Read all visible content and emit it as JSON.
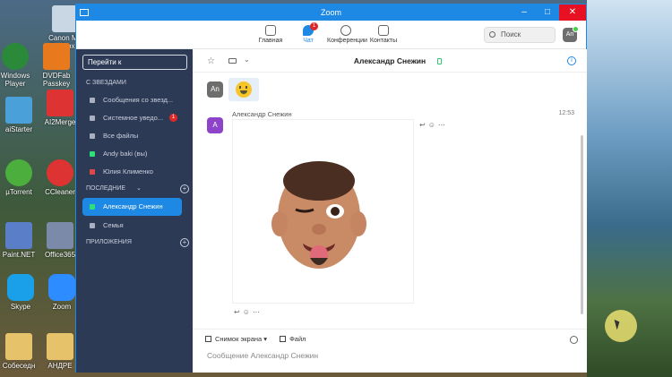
{
  "window": {
    "title": "Zoom"
  },
  "nav": [
    {
      "label": "Главная",
      "icon": "home-icon"
    },
    {
      "label": "Чат",
      "icon": "chat-icon",
      "badge": "1"
    },
    {
      "label": "Конференции",
      "icon": "clock-icon"
    },
    {
      "label": "Контакты",
      "icon": "contacts-icon"
    }
  ],
  "search": {
    "placeholder": "Поиск"
  },
  "user": {
    "avatar": "An"
  },
  "sidebar": {
    "goto": "Перейти к",
    "starred_label": "С ЗВЕЗДАМИ",
    "starred": [
      {
        "label": "Сообщения со звезд..."
      },
      {
        "label": "Системное уведо...",
        "count": "1"
      },
      {
        "label": "Все файлы"
      },
      {
        "label": "Andy baki (вы)"
      },
      {
        "label": "Юлия Клименко"
      }
    ],
    "recent_label": "ПОСЛЕДНИЕ",
    "recent": [
      {
        "label": "Александр Снежин"
      },
      {
        "label": "Семья"
      }
    ],
    "apps_label": "ПРИЛОЖЕНИЯ"
  },
  "chat": {
    "contact": "Александр Снежин",
    "messages": [
      {
        "avatar": "An",
        "type": "emoji"
      },
      {
        "avatar": "A",
        "sender": "Александр Снежин",
        "time": "12:53",
        "type": "image"
      }
    ],
    "composer": {
      "screenshot": "Снимок экрана",
      "file": "Файл",
      "placeholder": "Сообщение Александр Снежин"
    }
  },
  "desktop_icons": [
    "Canon MP Toolbox 4",
    "Windows Player",
    "DVDFab Passkey",
    "aiStarter",
    "AI2Merge",
    "µTorrent",
    "CCleaner",
    "Paint.NET",
    "Office365",
    "Skype",
    "Zoom",
    "Собеседн",
    "АНДРЕ"
  ],
  "colors": {
    "accent": "#1e88e5",
    "sidebar": "#2d3a56",
    "badge": "#e02828",
    "online": "#43d049"
  }
}
